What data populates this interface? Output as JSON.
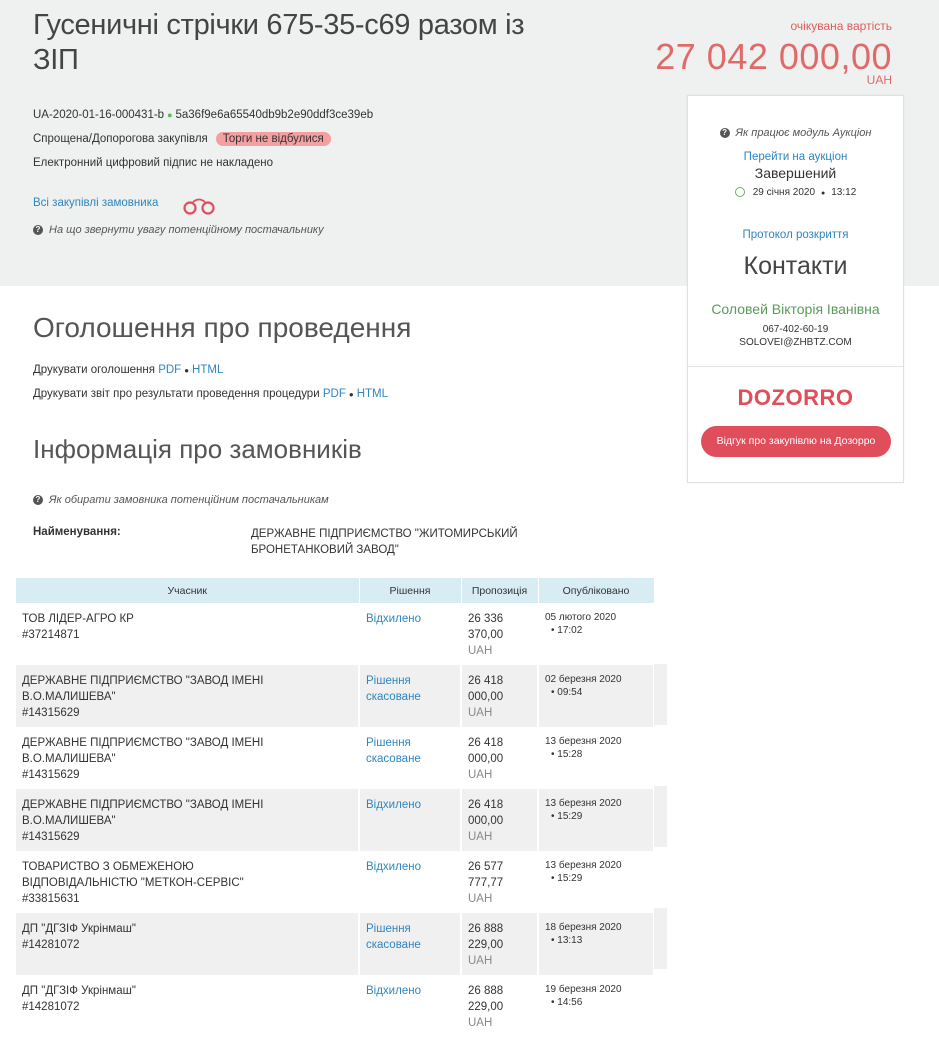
{
  "tender": {
    "title": "Гусеничні стрічки 675-35-с69 разом із ЗІП",
    "expected_label": "очікувана вартість",
    "expected_amount": "27 042 000,00",
    "currency": "UAH",
    "id": "UA-2020-01-16-000431-b",
    "hash": "5a36f9e6a65540db9b2e90ddf3ce39eb",
    "procedure": "Спрощена/Допорогова закупівля",
    "status_badge": "Торги не відбулися",
    "signature": "Електронний цифровий підпис не накладено",
    "all_purchases_link": "Всі закупівлі замовника",
    "attention_help": "На що звернути увагу потенційному постачальнику"
  },
  "sidebar": {
    "auction_help": "Як працює модуль Аукціон",
    "auction_link": "Перейти на аукціон",
    "auction_status": "Завершений",
    "auction_date": "29 січня 2020",
    "auction_time": "13:12",
    "protocol_link": "Протокол розкриття",
    "contacts_title": "Контакти",
    "contact_name": "Соловей Вікторія Іванівна",
    "contact_phone": "067-402-60-19",
    "contact_email": "SOLOVEI@ZHBTZ.COM",
    "dozorro_logo": "DOZORRO",
    "dozorro_button": "Відгук про закупівлю на Дозорро"
  },
  "announcement": {
    "title": "Оголошення про проведення",
    "print_notice_label": "Друкувати оголошення",
    "print_report_label": "Друкувати звіт про результати проведення процедури",
    "pdf": "PDF",
    "html": "HTML"
  },
  "customers": {
    "title": "Інформація про замовників",
    "help": "Як обирати замовника потенційним постачальникам",
    "name_label": "Найменування:",
    "name_value": "ДЕРЖАВНЕ ПІДПРИЄМСТВО \"ЖИТОМИРСЬКИЙ БРОНЕТАНКОВИЙ ЗАВОД\""
  },
  "bids": {
    "headers": [
      "Учасник",
      "Рішення",
      "Пропозиція",
      "Опубліковано"
    ],
    "rows": [
      {
        "name": "ТОВ ЛІДЕР-АГРО КР",
        "code": "#37214871",
        "decision": "Відхилено",
        "amount": "26 336 370,00",
        "currency": "UAH",
        "date": "05 лютого 2020",
        "time": "17:02"
      },
      {
        "name": "ДЕРЖАВНЕ ПІДПРИЄМСТВО \"ЗАВОД ІМЕНІ В.О.МАЛИШЕВА\"",
        "code": "#14315629",
        "decision": "Рішення скасоване",
        "amount": "26 418 000,00",
        "currency": "UAH",
        "date": "02 березня 2020",
        "time": "09:54"
      },
      {
        "name": "ДЕРЖАВНЕ ПІДПРИЄМСТВО \"ЗАВОД ІМЕНІ В.О.МАЛИШЕВА\"",
        "code": "#14315629",
        "decision": "Рішення скасоване",
        "amount": "26 418 000,00",
        "currency": "UAH",
        "date": "13 березня 2020",
        "time": "15:28"
      },
      {
        "name": "ДЕРЖАВНЕ ПІДПРИЄМСТВО \"ЗАВОД ІМЕНІ В.О.МАЛИШЕВА\"",
        "code": "#14315629",
        "decision": "Відхилено",
        "amount": "26 418 000,00",
        "currency": "UAH",
        "date": "13 березня 2020",
        "time": "15:29"
      },
      {
        "name": "ТОВАРИСТВО З ОБМЕЖЕНОЮ ВІДПОВІДАЛЬНІСТЮ \"МЕТКОН-СЕРВІС\"",
        "code": "#33815631",
        "decision": "Відхилено",
        "amount": "26 577 777,77",
        "currency": "UAH",
        "date": "13 березня 2020",
        "time": "15:29"
      },
      {
        "name": "ДП \"ДГЗІФ Укрінмаш\"",
        "code": "#14281072",
        "decision": "Рішення скасоване",
        "amount": "26 888 229,00",
        "currency": "UAH",
        "date": "18 березня 2020",
        "time": "13:13"
      },
      {
        "name": "ДП \"ДГЗІФ Укрінмаш\"",
        "code": "#14281072",
        "decision": "Відхилено",
        "amount": "26 888 229,00",
        "currency": "UAH",
        "date": "19 березня 2020",
        "time": "14:56"
      }
    ]
  },
  "colors": {
    "header_bg": "#eef1ef",
    "accent_red": "#e06a6a",
    "link_blue": "#2e86c1",
    "contact_green": "#5a9a5a",
    "dozorro_red": "#e04e5b",
    "table_header_bg": "#d8ecf3"
  },
  "icons": [
    "question-circle-icon",
    "clock-icon",
    "handcuffs-icon",
    "status-dot-icon"
  ]
}
